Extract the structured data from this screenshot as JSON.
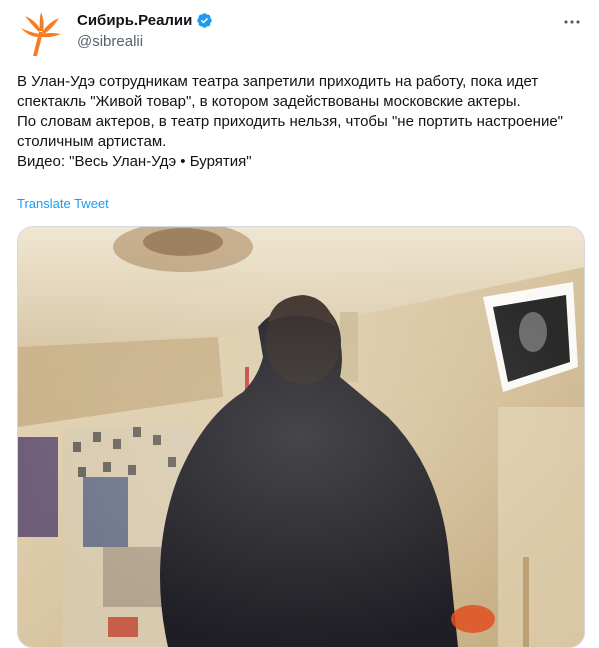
{
  "account": {
    "display_name": "Сибирь.Реалии",
    "handle": "@sibrealii",
    "verified": true,
    "avatar_icon": "rfe-rl-logo-icon",
    "brand_color": "#f57c22"
  },
  "menu_icon": "more-dots-icon",
  "tweet": {
    "lines": [
      "В Улан-Удэ сотрудникам театра запретили приходить на работу, пока идет спектакль \"Живой товар\", в котором задействованы московские актеры.",
      "По словам актеров, в театр приходить нельзя, чтобы \"не портить настроение\" столичным артистам.",
      "Видео: \"Весь Улан-Удэ • Бурятия\""
    ],
    "translate_label": "Translate Tweet"
  },
  "colors": {
    "text": "#0f1419",
    "secondary": "#536471",
    "link": "#1d9bf0"
  }
}
